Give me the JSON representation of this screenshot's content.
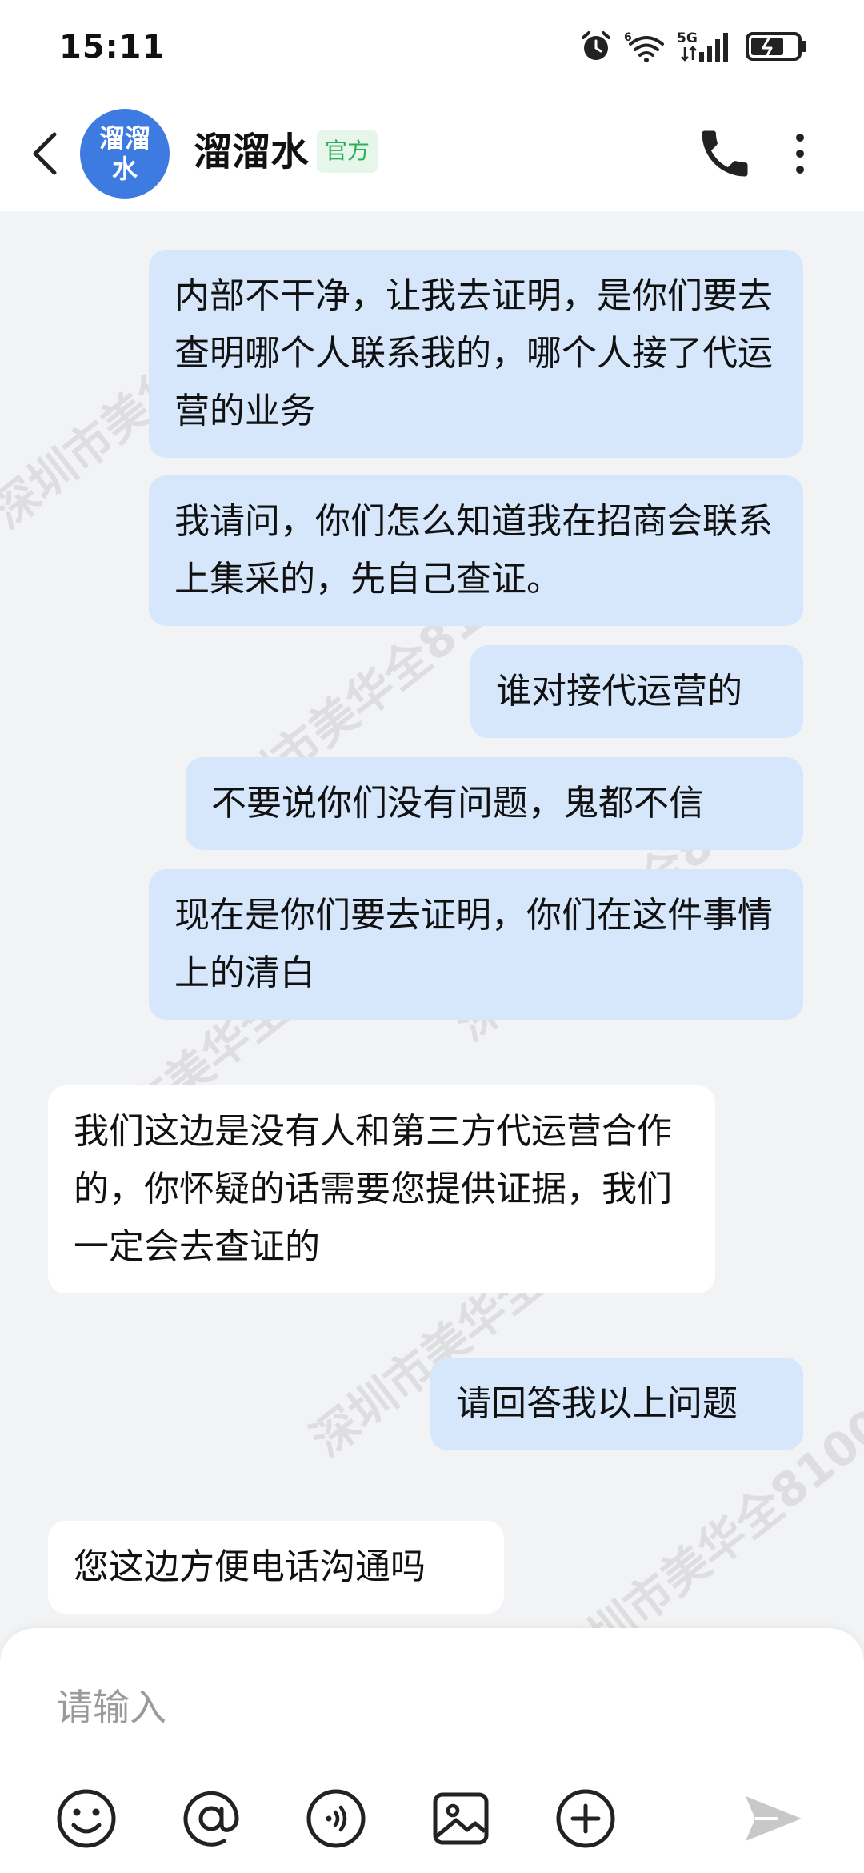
{
  "status_bar": {
    "time": "15:11",
    "network_label": "5G",
    "icons": [
      "alarm-icon",
      "wifi-icon",
      "signal-icon",
      "battery-icon"
    ]
  },
  "header": {
    "avatar_text": "溜溜水",
    "name": "溜溜水",
    "badge": "官方",
    "icons": [
      "back-icon",
      "phone-icon",
      "more-icon"
    ]
  },
  "messages": [
    {
      "sender": "me",
      "text": "内部不干净，让我去证明，是你们要去查明哪个人联系我的，哪个人接了代运营的业务"
    },
    {
      "sender": "me",
      "text": "我请问，你们怎么知道我在招商会联系上集采的，先自己查证。"
    },
    {
      "sender": "me",
      "text": "谁对接代运营的"
    },
    {
      "sender": "me",
      "text": "不要说你们没有问题，鬼都不信"
    },
    {
      "sender": "me",
      "text": "现在是你们要去证明，你们在这件事情上的清白"
    },
    {
      "sender": "other",
      "text": "我们这边是没有人和第三方代运营合作的，你怀疑的话需要您提供证据，我们一定会去查证的"
    },
    {
      "sender": "me",
      "text": "请回答我以上问题"
    },
    {
      "sender": "other",
      "text": "您这边方便电话沟通吗"
    }
  ],
  "watermark": "深圳市美华全8100",
  "input": {
    "placeholder": "请输入",
    "value": ""
  },
  "toolbar": [
    "emoji-icon",
    "mention-icon",
    "voice-icon",
    "image-icon",
    "add-icon",
    "send-icon"
  ],
  "colors": {
    "my_bubble": "#d6e6fb",
    "other_bubble": "#ffffff",
    "avatar": "#3d7be0",
    "badge_bg": "#e6f6ea",
    "badge_text": "#2fae57"
  }
}
